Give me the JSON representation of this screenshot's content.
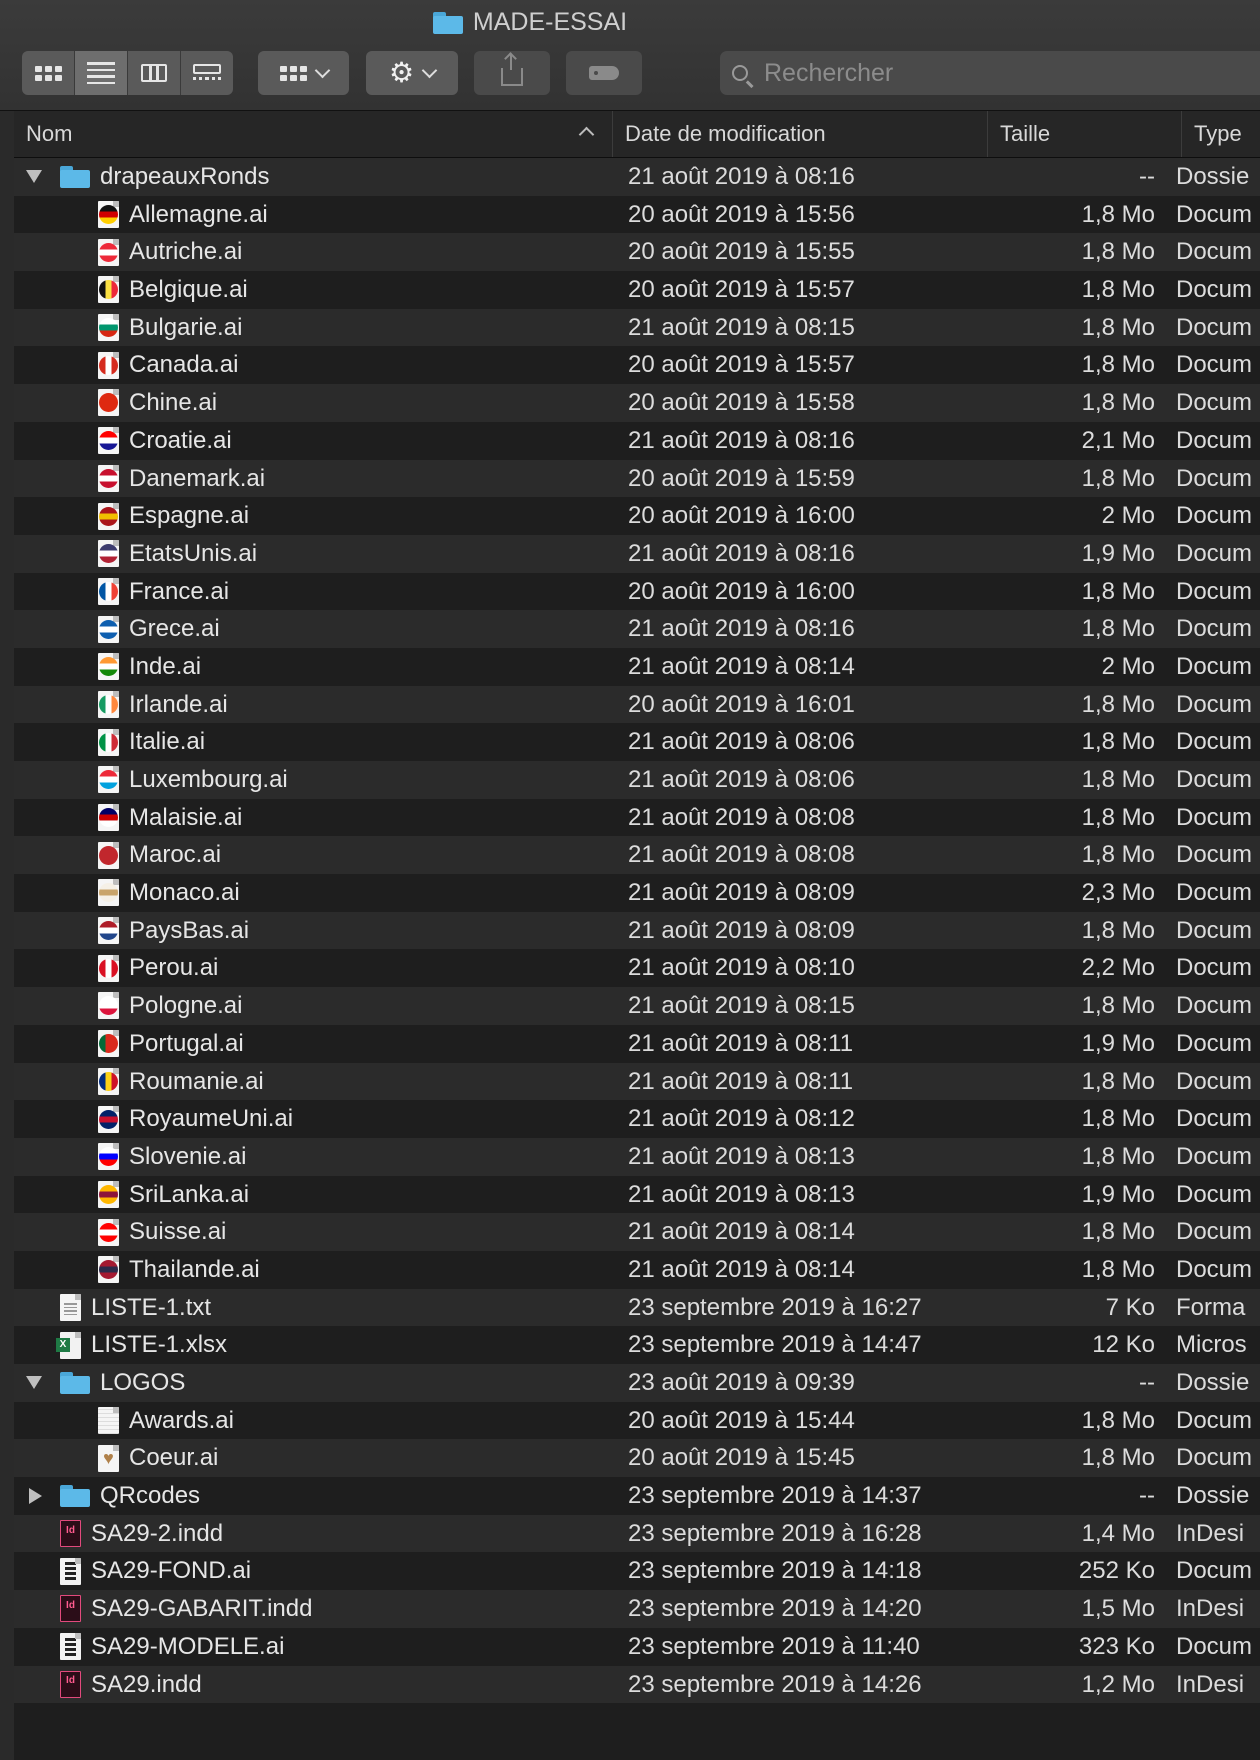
{
  "window": {
    "title": "MADE-ESSAI"
  },
  "toolbar": {
    "view_buttons": [
      "icon-view",
      "list-view",
      "column-view",
      "gallery-view"
    ],
    "active_view": "list-view",
    "search": {
      "placeholder": "Rechercher",
      "value": ""
    }
  },
  "columns": {
    "name": "Nom",
    "date": "Date de modification",
    "size": "Taille",
    "kind": "Type"
  },
  "rows": [
    {
      "level": 0,
      "disclosure": "open",
      "icon": "folder-icon",
      "name": "drapeauxRonds",
      "date": "21 août 2019 à 08:16",
      "size": "--",
      "kind": "Dossie"
    },
    {
      "level": 1,
      "icon": "flag-germany-icon",
      "flag": [
        "#111111",
        "#d00000",
        "#ffce00"
      ],
      "flagdir": "h",
      "name": "Allemagne.ai",
      "date": "20 août 2019 à 15:56",
      "size": "1,8 Mo",
      "kind": "Docum"
    },
    {
      "level": 1,
      "icon": "flag-austria-icon",
      "flag": [
        "#ed2939",
        "#ffffff",
        "#ed2939"
      ],
      "flagdir": "h",
      "name": "Autriche.ai",
      "date": "20 août 2019 à 15:55",
      "size": "1,8 Mo",
      "kind": "Docum"
    },
    {
      "level": 1,
      "icon": "flag-belgium-icon",
      "flag": [
        "#111111",
        "#fae042",
        "#ed2939"
      ],
      "flagdir": "v",
      "name": "Belgique.ai",
      "date": "20 août 2019 à 15:57",
      "size": "1,8 Mo",
      "kind": "Docum"
    },
    {
      "level": 1,
      "icon": "flag-bulgaria-icon",
      "flag": [
        "#ffffff",
        "#00966e",
        "#d62612"
      ],
      "flagdir": "h",
      "name": "Bulgarie.ai",
      "date": "21 août 2019 à 08:15",
      "size": "1,8 Mo",
      "kind": "Docum"
    },
    {
      "level": 1,
      "icon": "flag-canada-icon",
      "flag": [
        "#d52b1e",
        "#ffffff",
        "#d52b1e"
      ],
      "flagdir": "v",
      "name": "Canada.ai",
      "date": "20 août 2019 à 15:57",
      "size": "1,8 Mo",
      "kind": "Docum"
    },
    {
      "level": 1,
      "icon": "flag-china-icon",
      "flag": [
        "#de2910",
        "#de2910",
        "#de2910"
      ],
      "flagdir": "h",
      "name": "Chine.ai",
      "date": "20 août 2019 à 15:58",
      "size": "1,8 Mo",
      "kind": "Docum"
    },
    {
      "level": 1,
      "icon": "flag-croatia-icon",
      "flag": [
        "#ff0000",
        "#ffffff",
        "#171796"
      ],
      "flagdir": "h",
      "name": "Croatie.ai",
      "date": "21 août 2019 à 08:16",
      "size": "2,1 Mo",
      "kind": "Docum"
    },
    {
      "level": 1,
      "icon": "flag-denmark-icon",
      "flag": [
        "#c8102e",
        "#ffffff",
        "#c8102e"
      ],
      "flagdir": "h",
      "name": "Danemark.ai",
      "date": "20 août 2019 à 15:59",
      "size": "1,8 Mo",
      "kind": "Docum"
    },
    {
      "level": 1,
      "icon": "flag-spain-icon",
      "flag": [
        "#aa151b",
        "#f1bf00",
        "#aa151b"
      ],
      "flagdir": "h",
      "name": "Espagne.ai",
      "date": "20 août 2019 à 16:00",
      "size": "2 Mo",
      "kind": "Docum"
    },
    {
      "level": 1,
      "icon": "flag-usa-icon",
      "flag": [
        "#3c3b6e",
        "#ffffff",
        "#b22234"
      ],
      "flagdir": "h",
      "name": "EtatsUnis.ai",
      "date": "21 août 2019 à 08:16",
      "size": "1,9 Mo",
      "kind": "Docum"
    },
    {
      "level": 1,
      "icon": "flag-france-icon",
      "flag": [
        "#0055a4",
        "#ffffff",
        "#ef4135"
      ],
      "flagdir": "v",
      "name": "France.ai",
      "date": "20 août 2019 à 16:00",
      "size": "1,8 Mo",
      "kind": "Docum"
    },
    {
      "level": 1,
      "icon": "flag-greece-icon",
      "flag": [
        "#0d5eaf",
        "#ffffff",
        "#0d5eaf"
      ],
      "flagdir": "h",
      "name": "Grece.ai",
      "date": "21 août 2019 à 08:16",
      "size": "1,8 Mo",
      "kind": "Docum"
    },
    {
      "level": 1,
      "icon": "flag-india-icon",
      "flag": [
        "#ff9933",
        "#ffffff",
        "#138808"
      ],
      "flagdir": "h",
      "name": "Inde.ai",
      "date": "21 août 2019 à 08:14",
      "size": "2 Mo",
      "kind": "Docum"
    },
    {
      "level": 1,
      "icon": "flag-ireland-icon",
      "flag": [
        "#169b62",
        "#ffffff",
        "#ff883e"
      ],
      "flagdir": "v",
      "name": "Irlande.ai",
      "date": "20 août 2019 à 16:01",
      "size": "1,8 Mo",
      "kind": "Docum"
    },
    {
      "level": 1,
      "icon": "flag-italy-icon",
      "flag": [
        "#009246",
        "#ffffff",
        "#ce2b37"
      ],
      "flagdir": "v",
      "name": "Italie.ai",
      "date": "21 août 2019 à 08:06",
      "size": "1,8 Mo",
      "kind": "Docum"
    },
    {
      "level": 1,
      "icon": "flag-luxembourg-icon",
      "flag": [
        "#ed2939",
        "#ffffff",
        "#00a1de"
      ],
      "flagdir": "h",
      "name": "Luxembourg.ai",
      "date": "21 août 2019 à 08:06",
      "size": "1,8 Mo",
      "kind": "Docum"
    },
    {
      "level": 1,
      "icon": "flag-malaysia-icon",
      "flag": [
        "#010066",
        "#cc0001",
        "#ffffff"
      ],
      "flagdir": "h",
      "name": "Malaisie.ai",
      "date": "21 août 2019 à 08:08",
      "size": "1,8 Mo",
      "kind": "Docum"
    },
    {
      "level": 1,
      "icon": "flag-morocco-icon",
      "flag": [
        "#c1272d",
        "#c1272d",
        "#c1272d"
      ],
      "flagdir": "h",
      "name": "Maroc.ai",
      "date": "21 août 2019 à 08:08",
      "size": "1,8 Mo",
      "kind": "Docum"
    },
    {
      "level": 1,
      "icon": "flag-monaco-icon",
      "flag": [
        "#f5f0e6",
        "#c9a46a",
        "#f5f0e6"
      ],
      "flagdir": "h",
      "name": "Monaco.ai",
      "date": "21 août 2019 à 08:09",
      "size": "2,3 Mo",
      "kind": "Docum"
    },
    {
      "level": 1,
      "icon": "flag-netherlands-icon",
      "flag": [
        "#ae1c28",
        "#ffffff",
        "#21468b"
      ],
      "flagdir": "h",
      "name": "PaysBas.ai",
      "date": "21 août 2019 à 08:09",
      "size": "1,8 Mo",
      "kind": "Docum"
    },
    {
      "level": 1,
      "icon": "flag-peru-icon",
      "flag": [
        "#d91023",
        "#ffffff",
        "#d91023"
      ],
      "flagdir": "v",
      "name": "Perou.ai",
      "date": "21 août 2019 à 08:10",
      "size": "2,2 Mo",
      "kind": "Docum"
    },
    {
      "level": 1,
      "icon": "flag-poland-icon",
      "flag": [
        "#ffffff",
        "#ffffff",
        "#dc143c"
      ],
      "flagdir": "h",
      "name": "Pologne.ai",
      "date": "21 août 2019 à 08:15",
      "size": "1,8 Mo",
      "kind": "Docum"
    },
    {
      "level": 1,
      "icon": "flag-portugal-icon",
      "flag": [
        "#046a38",
        "#da291c",
        "#da291c"
      ],
      "flagdir": "v",
      "name": "Portugal.ai",
      "date": "21 août 2019 à 08:11",
      "size": "1,9 Mo",
      "kind": "Docum"
    },
    {
      "level": 1,
      "icon": "flag-romania-icon",
      "flag": [
        "#002b7f",
        "#fcd116",
        "#ce1126"
      ],
      "flagdir": "v",
      "name": "Roumanie.ai",
      "date": "21 août 2019 à 08:11",
      "size": "1,8 Mo",
      "kind": "Docum"
    },
    {
      "level": 1,
      "icon": "flag-uk-icon",
      "flag": [
        "#012169",
        "#c8102e",
        "#012169"
      ],
      "flagdir": "h",
      "name": "RoyaumeUni.ai",
      "date": "21 août 2019 à 08:12",
      "size": "1,8 Mo",
      "kind": "Docum"
    },
    {
      "level": 1,
      "icon": "flag-slovenia-icon",
      "flag": [
        "#ffffff",
        "#0000ff",
        "#ff0000"
      ],
      "flagdir": "h",
      "name": "Slovenie.ai",
      "date": "21 août 2019 à 08:13",
      "size": "1,8 Mo",
      "kind": "Docum"
    },
    {
      "level": 1,
      "icon": "flag-srilanka-icon",
      "flag": [
        "#ffb700",
        "#8d153a",
        "#ffb700"
      ],
      "flagdir": "h",
      "name": "SriLanka.ai",
      "date": "21 août 2019 à 08:13",
      "size": "1,9 Mo",
      "kind": "Docum"
    },
    {
      "level": 1,
      "icon": "flag-switzerland-icon",
      "flag": [
        "#ff0000",
        "#ffffff",
        "#ff0000"
      ],
      "flagdir": "h",
      "name": "Suisse.ai",
      "date": "21 août 2019 à 08:14",
      "size": "1,8 Mo",
      "kind": "Docum"
    },
    {
      "level": 1,
      "icon": "flag-thailand-icon",
      "flag": [
        "#a51931",
        "#2d2a4a",
        "#a51931"
      ],
      "flagdir": "h",
      "name": "Thailande.ai",
      "date": "21 août 2019 à 08:14",
      "size": "1,8 Mo",
      "kind": "Docum"
    },
    {
      "level": 0,
      "icon": "text-file-icon",
      "name": "LISTE-1.txt",
      "date": "23 septembre 2019 à 16:27",
      "size": "7 Ko",
      "kind": "Forma"
    },
    {
      "level": 0,
      "icon": "excel-file-icon",
      "name": "LISTE-1.xlsx",
      "date": "23 septembre 2019 à 14:47",
      "size": "12 Ko",
      "kind": "Micros"
    },
    {
      "level": 0,
      "disclosure": "open",
      "icon": "folder-icon",
      "name": "LOGOS",
      "date": "23 août 2019 à 09:39",
      "size": "--",
      "kind": "Dossie"
    },
    {
      "level": 1,
      "icon": "awards-file-icon",
      "name": "Awards.ai",
      "date": "20 août 2019 à 15:44",
      "size": "1,8 Mo",
      "kind": "Docum"
    },
    {
      "level": 1,
      "icon": "heart-file-icon",
      "name": "Coeur.ai",
      "date": "20 août 2019 à 15:45",
      "size": "1,8 Mo",
      "kind": "Docum"
    },
    {
      "level": 0,
      "disclosure": "closed",
      "icon": "folder-icon",
      "name": "QRcodes",
      "date": "23 septembre 2019 à 14:37",
      "size": "--",
      "kind": "Dossie"
    },
    {
      "level": 0,
      "icon": "indesign-file-icon",
      "name": "SA29-2.indd",
      "date": "23 septembre 2019 à 16:28",
      "size": "1,4 Mo",
      "kind": "InDesi"
    },
    {
      "level": 0,
      "icon": "illustrator-file-icon",
      "name": "SA29-FOND.ai",
      "date": "23 septembre 2019 à 14:18",
      "size": "252 Ko",
      "kind": "Docum"
    },
    {
      "level": 0,
      "icon": "indesign-file-icon",
      "name": "SA29-GABARIT.indd",
      "date": "23 septembre 2019 à 14:20",
      "size": "1,5 Mo",
      "kind": "InDesi"
    },
    {
      "level": 0,
      "icon": "illustrator-file-icon",
      "name": "SA29-MODELE.ai",
      "date": "23 septembre 2019 à 11:40",
      "size": "323 Ko",
      "kind": "Docum"
    },
    {
      "level": 0,
      "icon": "indesign-file-icon",
      "name": "SA29.indd",
      "date": "23 septembre 2019 à 14:26",
      "size": "1,2 Mo",
      "kind": "InDesi"
    }
  ]
}
